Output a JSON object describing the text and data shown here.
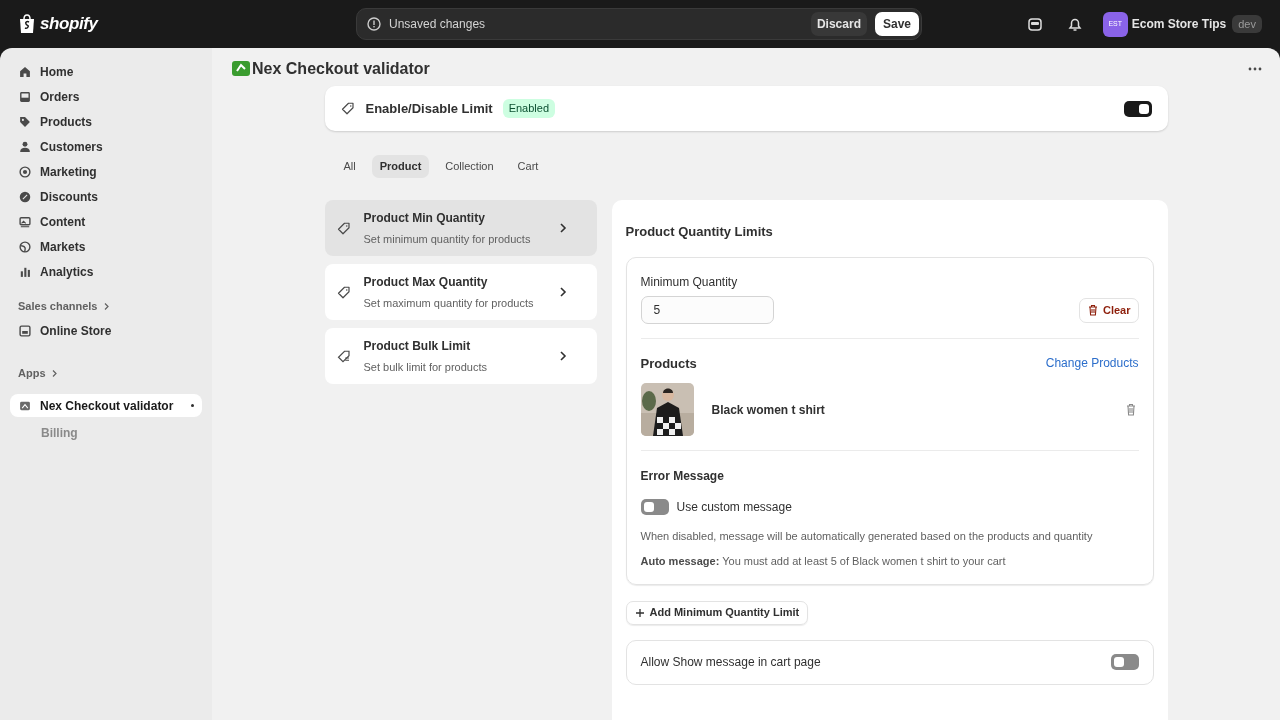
{
  "top_bar": {
    "logo": "shopify",
    "unsaved": {
      "text": "Unsaved changes",
      "discard": "Discard",
      "save": "Save"
    },
    "store": {
      "initials": "EST",
      "name": "Ecom Store Tips",
      "badge": "dev"
    }
  },
  "sidebar": {
    "items": [
      {
        "label": "Home",
        "selected": false
      },
      {
        "label": "Orders",
        "selected": false
      },
      {
        "label": "Products",
        "selected": false
      },
      {
        "label": "Customers",
        "selected": false
      },
      {
        "label": "Marketing",
        "selected": false
      },
      {
        "label": "Discounts",
        "selected": false
      },
      {
        "label": "Content",
        "selected": false
      },
      {
        "label": "Markets",
        "selected": false
      },
      {
        "label": "Analytics",
        "selected": false
      }
    ],
    "sales_channels": {
      "heading": "Sales channels",
      "items": [
        {
          "label": "Online Store",
          "selected": false
        }
      ]
    },
    "apps": {
      "heading": "Apps",
      "items": [
        {
          "label": "Nex Checkout validator",
          "selected": true,
          "children": [
            {
              "label": "Billing",
              "selected": false
            }
          ]
        }
      ]
    }
  },
  "page": {
    "title": "Nex Checkout validator"
  },
  "enable_card": {
    "title": "Enable/Disable Limit",
    "badge": "Enabled",
    "on": true
  },
  "tabs": [
    {
      "label": "All",
      "selected": false
    },
    {
      "label": "Product",
      "selected": true
    },
    {
      "label": "Collection",
      "selected": false
    },
    {
      "label": "Cart",
      "selected": false
    }
  ],
  "limit_types": [
    {
      "title": "Product Min Quantity",
      "description": "Set minimum quantity for products",
      "selected": true
    },
    {
      "title": "Product Max Quantity",
      "description": "Set maximum quantity for products",
      "selected": false
    },
    {
      "title": "Product Bulk Limit",
      "description": "Set bulk limit for products",
      "selected": false
    }
  ],
  "panel": {
    "title": "Product Quantity Limits",
    "limit": {
      "field_label": "Minimum Quantity",
      "value": "5",
      "clear": "Clear",
      "products_heading": "Products",
      "change_products": "Change Products",
      "products": [
        {
          "name": "Black women t shirt",
          "kind": "picture"
        }
      ],
      "error_heading": "Error Message",
      "custom_toggle": {
        "label": "Use custom message",
        "on": false
      },
      "hint": "When disabled, message will be automatically generated based on the products and quantity",
      "auto_message": "**Auto message:** You must add at least 5 of Black women t shirt to your cart"
    },
    "add_button": "Add Minimum Quantity Limit",
    "cart_toggle": {
      "label": "Allow Show message in cart page",
      "on": false
    }
  }
}
